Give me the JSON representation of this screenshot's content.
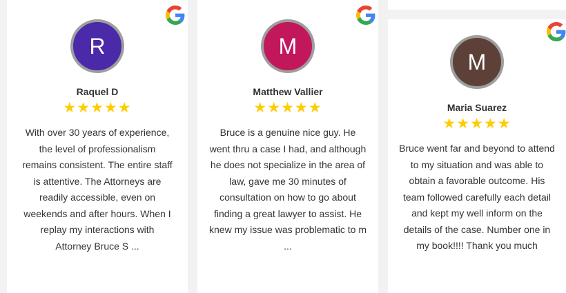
{
  "colors": {
    "star": "#ffcc00",
    "text": "#333333",
    "avatar_border": "#9e9e9e",
    "google_blue": "#4285F4",
    "google_red": "#EA4335",
    "google_yellow": "#FBBC05",
    "google_green": "#34A853"
  },
  "reviews": [
    {
      "initial": "R",
      "avatar_color": "#4a2aa8",
      "name": "Raquel D",
      "rating": 5,
      "stars": "★★★★★",
      "source_icon": "google-icon",
      "text": "With over 30 years of experience, the level of professionalism remains consistent. The entire staff is attentive. The Attorneys are readily accessible, even on weekends and after hours. When I replay my interactions with Attorney Bruce S ..."
    },
    {
      "initial": "M",
      "avatar_color": "#c2185b",
      "name": "Matthew Vallier",
      "rating": 5,
      "stars": "★★★★★",
      "source_icon": "google-icon",
      "text": "Bruce is a genuine nice guy. He went thru a case I had, and although he does not specialize in the area of law, gave me 30 minutes of consultation on how to go about finding a great lawyer to assist. He knew my issue was problematic to m ..."
    },
    {
      "initial": "M",
      "avatar_color": "#5d4037",
      "name": "Maria Suarez",
      "rating": 5,
      "stars": "★★★★★",
      "source_icon": "google-icon",
      "text": "Bruce went far and beyond to attend to my situation and was able to obtain a favorable outcome. His team followed carefully each detail and kept my well inform on the details of the case. Number one in my book!!!! Thank you much"
    }
  ]
}
